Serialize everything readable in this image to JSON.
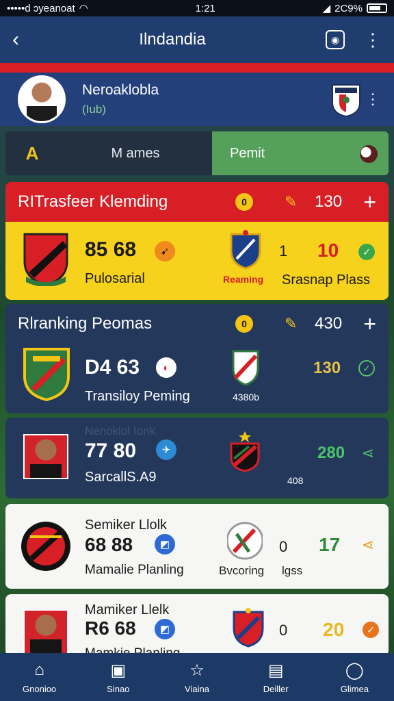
{
  "status": {
    "carrier": "•••••d ɔyeanoat",
    "time": "1:21",
    "battery": "2C9%"
  },
  "topbar": {
    "title": "Ilndandia"
  },
  "club": {
    "name": "Neroaklobla",
    "sub": "(Iub)"
  },
  "tabs": {
    "a": "A",
    "names": "M ames",
    "permit": "Pemit"
  },
  "cards": [
    {
      "title": "RITrasfeer Klemding",
      "coin": "0",
      "head_num": "130",
      "big": "85 68",
      "label": "Pulosarial",
      "mid_label": "Reaming",
      "n1": "1",
      "n2": "10",
      "right_label": "Srasnap Plass"
    },
    {
      "title": "Rlranking Peomas",
      "coin": "0",
      "head_num": "430",
      "big": "D4 63",
      "label": "Transiloy Peming",
      "mid_label": "4380b",
      "n2": "130"
    },
    {
      "faded": "Nenoklol Ionk",
      "big": "77 80",
      "label": "SarcallS.A9",
      "mid_label": "408",
      "n2": "280"
    },
    {
      "title": "Semiker Llolk",
      "big": "68 88",
      "label": "Mamalie Planling",
      "mid_label": "Bvcoring",
      "n1": "0",
      "right_label": "lgss",
      "n2": "17"
    },
    {
      "title": "Mamiker Llelk",
      "big": "R6 68",
      "label": "Mamkie Planling",
      "n1": "0",
      "n2": "20"
    }
  ],
  "nav": [
    {
      "label": "Gnonioo",
      "icon": "home-icon"
    },
    {
      "label": "Sinao",
      "icon": "squad-icon"
    },
    {
      "label": "Viaina",
      "icon": "tactics-icon"
    },
    {
      "label": "Deiller",
      "icon": "document-icon"
    },
    {
      "label": "Glimea",
      "icon": "profile-icon"
    }
  ],
  "colors": {
    "red": "#d81f26",
    "yellow": "#f6d21d",
    "navy": "#24385c",
    "green": "#55a05a"
  }
}
